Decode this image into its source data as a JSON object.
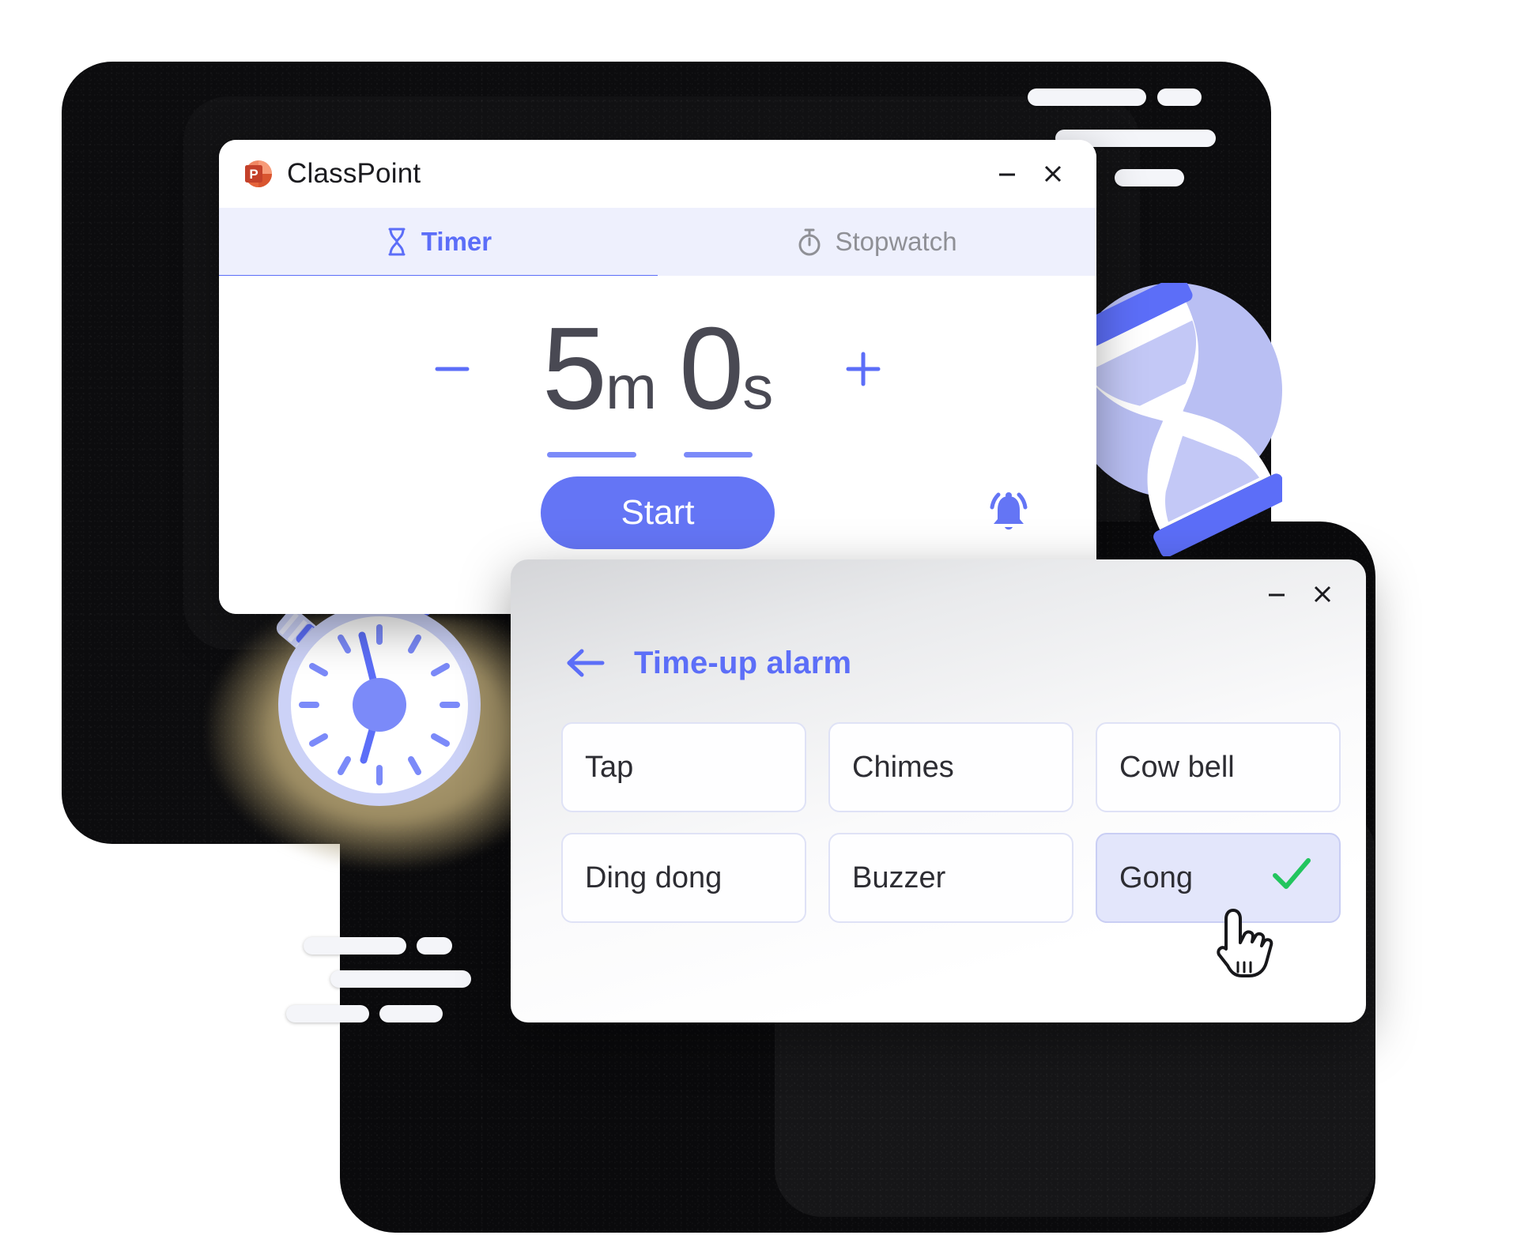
{
  "timer_window": {
    "app_title": "ClassPoint",
    "logo_icon": "powerpoint-logo",
    "controls": {
      "minimize_label": "Minimize",
      "close_label": "Close"
    },
    "tabs": [
      {
        "label": "Timer",
        "icon": "hourglass-icon",
        "active": true
      },
      {
        "label": "Stopwatch",
        "icon": "stopwatch-icon",
        "active": false
      }
    ],
    "time": {
      "minutes": "5",
      "minutes_unit": "m",
      "seconds": "0",
      "seconds_unit": "s",
      "decrease_label": "−",
      "increase_label": "+"
    },
    "start_label": "Start",
    "alarm_icon": "bell-ring-icon"
  },
  "alarm_window": {
    "controls": {
      "minimize_label": "Minimize",
      "close_label": "Close"
    },
    "back_icon": "arrow-left-icon",
    "heading": "Time-up alarm",
    "options": [
      {
        "label": "Tap",
        "selected": false
      },
      {
        "label": "Chimes",
        "selected": false
      },
      {
        "label": "Cow bell",
        "selected": false
      },
      {
        "label": "Ding dong",
        "selected": false
      },
      {
        "label": "Buzzer",
        "selected": false
      },
      {
        "label": "Gong",
        "selected": true
      }
    ],
    "selected_check_icon": "green-check-icon",
    "cursor_icon": "hand-pointer-cursor"
  },
  "decorations": {
    "stopwatch_illustration": "stopwatch-illustration",
    "hourglass_illustration": "hourglass-illustration",
    "speed_dashes": "speed-line-dashes"
  },
  "colors": {
    "accent": "#5c6ef8",
    "button": "#6475f5",
    "tab_bar": "#eef0fd",
    "selected_option_bg": "#e3e6fb",
    "check_green": "#22c55e",
    "text_dark": "#1b1b1f",
    "time_text": "#494953",
    "powerpoint_orange": "#e8663b",
    "powerpoint_dark": "#c4412a"
  }
}
